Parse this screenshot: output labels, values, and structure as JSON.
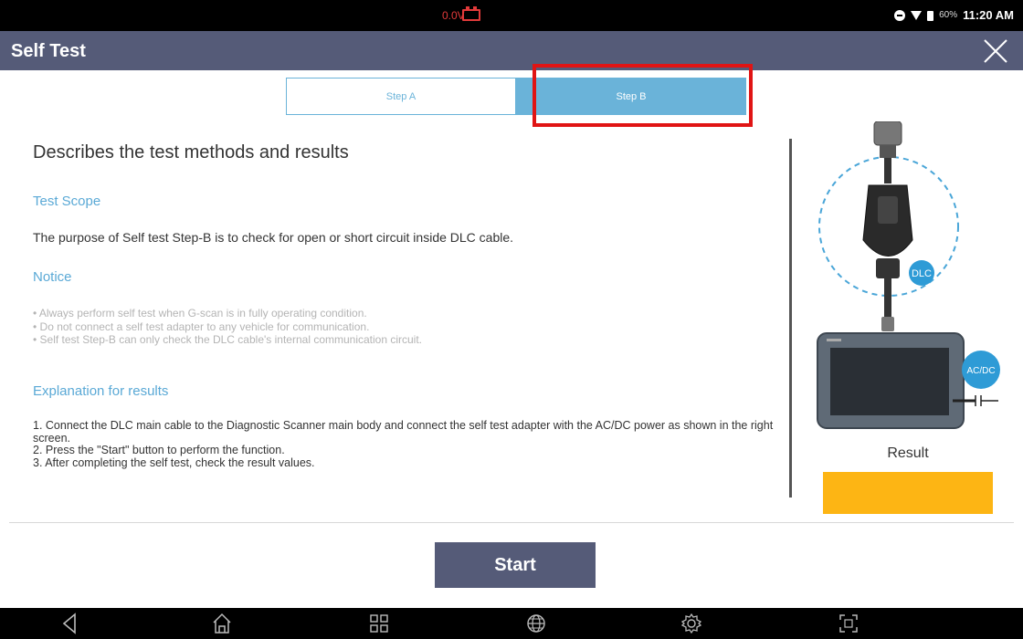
{
  "status_bar": {
    "voltage": "0.0V",
    "battery_percent": "60%",
    "time": "11:20 AM",
    "icons": [
      "battery-warning-icon",
      "do-not-disturb-icon",
      "wifi-icon",
      "battery-icon"
    ]
  },
  "title_bar": {
    "title": "Self Test",
    "close_icon": "close-icon"
  },
  "tabs": [
    {
      "label": "Step A",
      "selected": false
    },
    {
      "label": "Step B",
      "selected": true
    }
  ],
  "content": {
    "heading": "Describes the test methods and results",
    "test_scope": {
      "heading": "Test Scope",
      "text": "The purpose of Self test Step-B is to check for open or short circuit inside DLC cable."
    },
    "notice": {
      "heading": "Notice",
      "items": [
        "• Always perform self test when G-scan is in fully operating condition.",
        "• Do not connect a self test adapter to any vehicle for communication.",
        "• Self test Step-B can only check the DLC cable's internal communication circuit."
      ]
    },
    "explanation": {
      "heading": "Explanation for results",
      "items": [
        "1. Connect the DLC main cable to the Diagnostic Scanner main body and connect the self test adapter with the AC/DC power as shown in the right screen.",
        "2. Press the \"Start\" button to perform the function.",
        "3. After completing the self test, check the result values."
      ]
    }
  },
  "illustration": {
    "dlc_label": "DLC",
    "acdc_label": "AC/DC"
  },
  "result": {
    "label": "Result",
    "color": "#fdb514"
  },
  "actions": {
    "start_label": "Start"
  },
  "nav_bar": {
    "icons": [
      "back-icon",
      "home-icon",
      "apps-icon",
      "globe-icon",
      "settings-icon",
      "screenshot-icon"
    ]
  },
  "colors": {
    "title_bar": "#555b78",
    "accent": "#6ab3d9",
    "highlight": "#e01414"
  }
}
